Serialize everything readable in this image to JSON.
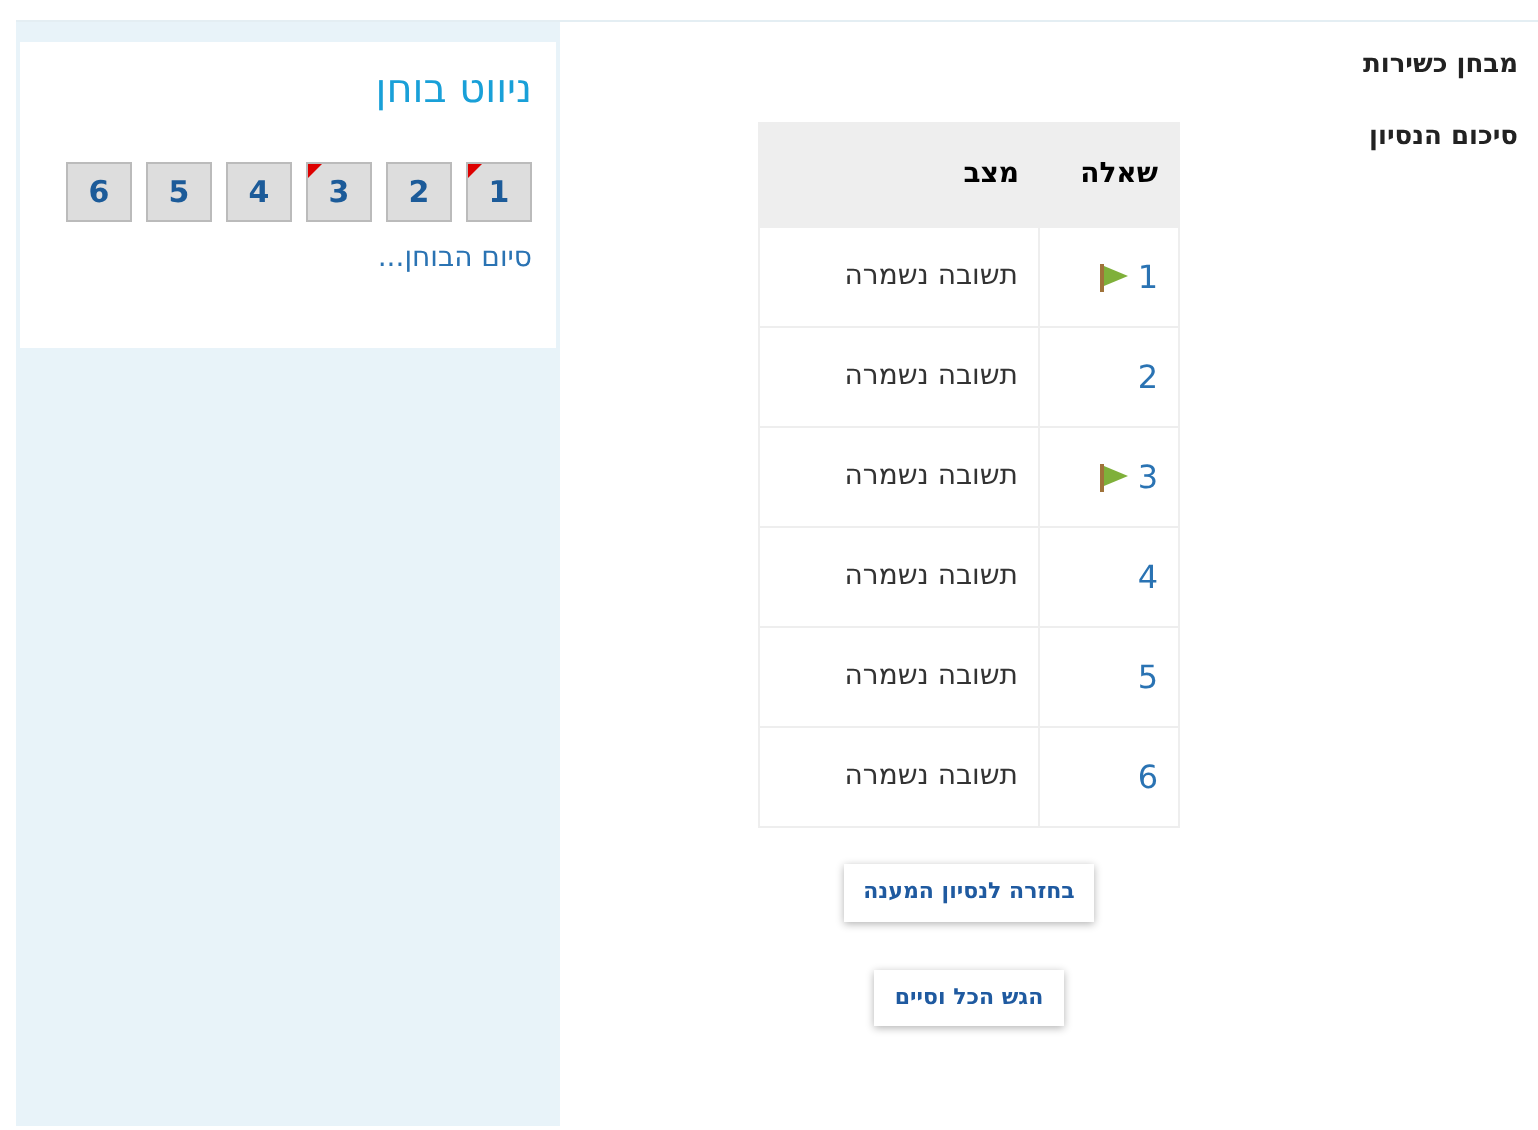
{
  "quiz": {
    "title": "מבחן כשירות",
    "subtitle": "סיכום הנסיון"
  },
  "table": {
    "columns": [
      "שאלה",
      "מצב"
    ],
    "rows": [
      {
        "question": "1",
        "status": "תשובה נשמרה",
        "flagged": true
      },
      {
        "question": "2",
        "status": "תשובה נשמרה",
        "flagged": false
      },
      {
        "question": "3",
        "status": "תשובה נשמרה",
        "flagged": true
      },
      {
        "question": "4",
        "status": "תשובה נשמרה",
        "flagged": false
      },
      {
        "question": "5",
        "status": "תשובה נשמרה",
        "flagged": false
      },
      {
        "question": "6",
        "status": "תשובה נשמרה",
        "flagged": false
      }
    ]
  },
  "buttons": [
    "בחזרה לנסיון המענה",
    "הגש הכל וסיים"
  ],
  "navigation": {
    "title": "ניווט בוחן",
    "items": [
      {
        "label": "1",
        "flagged": true
      },
      {
        "label": "2",
        "flagged": false
      },
      {
        "label": "3",
        "flagged": true
      },
      {
        "label": "4",
        "flagged": false
      },
      {
        "label": "5",
        "flagged": false
      },
      {
        "label": "6",
        "flagged": false
      }
    ],
    "finish_link": "סיום הבוחן..."
  }
}
